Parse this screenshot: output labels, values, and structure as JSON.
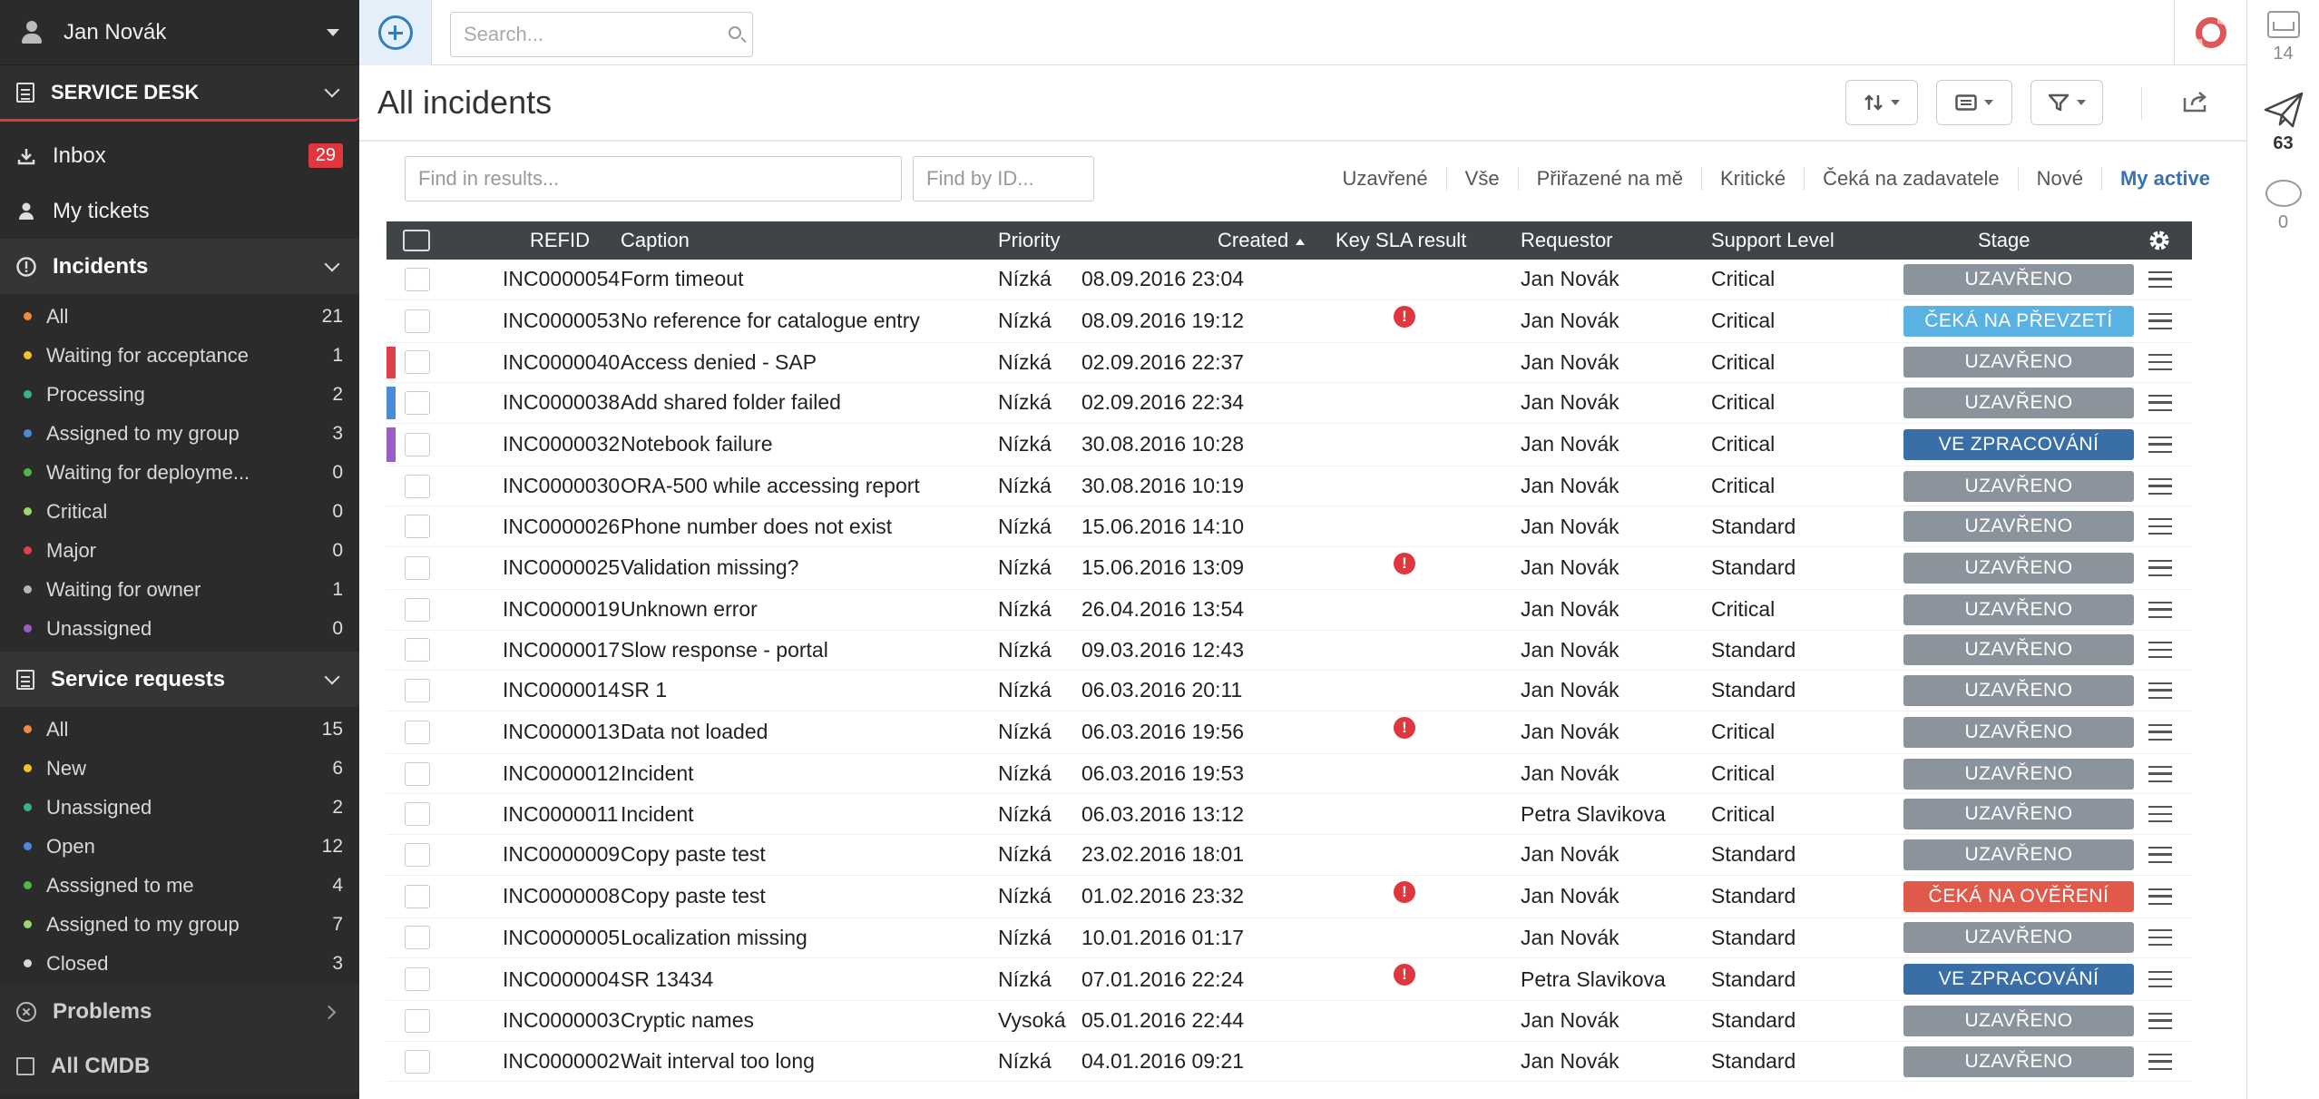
{
  "user": {
    "name": "Jan Novák"
  },
  "sidebar": {
    "service_desk": "SERVICE DESK",
    "inbox": {
      "label": "Inbox",
      "count": "29"
    },
    "my_tickets": "My tickets",
    "incidents": {
      "label": "Incidents",
      "items": [
        {
          "label": "All",
          "count": "21",
          "color": "#f08a3e"
        },
        {
          "label": "Waiting for acceptance",
          "count": "1",
          "color": "#f2c230"
        },
        {
          "label": "Processing",
          "count": "2",
          "color": "#3bb08f"
        },
        {
          "label": "Assigned to my group",
          "count": "3",
          "color": "#4a8ad6"
        },
        {
          "label": "Waiting for deployme...",
          "count": "0",
          "color": "#4cb848"
        },
        {
          "label": "Critical",
          "count": "0",
          "color": "#9bd66b"
        },
        {
          "label": "Major",
          "count": "0",
          "color": "#e0404a"
        },
        {
          "label": "Waiting for owner",
          "count": "1",
          "color": "#b5b5b5"
        },
        {
          "label": "Unassigned",
          "count": "0",
          "color": "#9a5cc6"
        }
      ]
    },
    "service_requests": {
      "label": "Service requests",
      "items": [
        {
          "label": "All",
          "count": "15",
          "color": "#f08a3e"
        },
        {
          "label": "New",
          "count": "6",
          "color": "#f2c230"
        },
        {
          "label": "Unassigned",
          "count": "2",
          "color": "#3bb08f"
        },
        {
          "label": "Open",
          "count": "12",
          "color": "#4a8ad6"
        },
        {
          "label": "Asssigned to me",
          "count": "4",
          "color": "#4cb848"
        },
        {
          "label": "Assigned to my group",
          "count": "7",
          "color": "#9bd66b"
        },
        {
          "label": "Closed",
          "count": "3",
          "color": "#d8d8d8"
        }
      ]
    },
    "problems": "Problems",
    "cmdb": "All CMDB"
  },
  "topbar": {
    "search_placeholder": "Search..."
  },
  "rail": {
    "inbox_count": "14",
    "sent_count": "63",
    "comments_count": "0"
  },
  "main": {
    "title": "All incidents",
    "find_results_placeholder": "Find in results...",
    "find_id_placeholder": "Find by ID...",
    "quick_filters": [
      "Uzavřené",
      "Vše",
      "Přiřazené na mě",
      "Kritické",
      "Čeká na zadavatele",
      "Nové",
      "My active"
    ]
  },
  "table": {
    "headers": {
      "refid": "REFID",
      "caption": "Caption",
      "priority": "Priority",
      "created": "Created",
      "sla": "Key SLA result",
      "requestor": "Requestor",
      "support": "Support Level",
      "stage": "Stage"
    },
    "stage_colors": {
      "UZAVŘENO": "#8b939c",
      "ČEKÁ NA PŘEVZETÍ": "#5ab2e2",
      "VE ZPRACOVÁNÍ": "#3a6ea7",
      "ČEKÁ NA OVĚŘENÍ": "#e0594b"
    },
    "rows": [
      {
        "refid": "INC0000054",
        "caption": "Form timeout",
        "priority": "Nízká",
        "created": "08.09.2016 23:04",
        "sla": false,
        "requestor": "Jan Novák",
        "support": "Critical",
        "stage": "UZAVŘENO",
        "mark": ""
      },
      {
        "refid": "INC0000053",
        "caption": "No reference for catalogue entry",
        "priority": "Nízká",
        "created": "08.09.2016 19:12",
        "sla": true,
        "requestor": "Jan Novák",
        "support": "Critical",
        "stage": "ČEKÁ NA PŘEVZETÍ",
        "mark": ""
      },
      {
        "refid": "INC0000040",
        "caption": "Access denied - SAP",
        "priority": "Nízká",
        "created": "02.09.2016 22:37",
        "sla": false,
        "requestor": "Jan Novák",
        "support": "Critical",
        "stage": "UZAVŘENO",
        "mark": "#e0404a"
      },
      {
        "refid": "INC0000038",
        "caption": "Add shared folder failed",
        "priority": "Nízká",
        "created": "02.09.2016 22:34",
        "sla": false,
        "requestor": "Jan Novák",
        "support": "Critical",
        "stage": "UZAVŘENO",
        "mark": "#4a8ad6"
      },
      {
        "refid": "INC0000032",
        "caption": "Notebook failure",
        "priority": "Nízká",
        "created": "30.08.2016 10:28",
        "sla": false,
        "requestor": "Jan Novák",
        "support": "Critical",
        "stage": "VE ZPRACOVÁNÍ",
        "mark": "#9a5cc6"
      },
      {
        "refid": "INC0000030",
        "caption": "ORA-500 while accessing report",
        "priority": "Nízká",
        "created": "30.08.2016 10:19",
        "sla": false,
        "requestor": "Jan Novák",
        "support": "Critical",
        "stage": "UZAVŘENO",
        "mark": ""
      },
      {
        "refid": "INC0000026",
        "caption": "Phone number does not exist",
        "priority": "Nízká",
        "created": "15.06.2016 14:10",
        "sla": false,
        "requestor": "Jan Novák",
        "support": "Standard",
        "stage": "UZAVŘENO",
        "mark": ""
      },
      {
        "refid": "INC0000025",
        "caption": "Validation missing?",
        "priority": "Nízká",
        "created": "15.06.2016 13:09",
        "sla": true,
        "requestor": "Jan Novák",
        "support": "Standard",
        "stage": "UZAVŘENO",
        "mark": ""
      },
      {
        "refid": "INC0000019",
        "caption": "Unknown error",
        "priority": "Nízká",
        "created": "26.04.2016 13:54",
        "sla": false,
        "requestor": "Jan Novák",
        "support": "Critical",
        "stage": "UZAVŘENO",
        "mark": ""
      },
      {
        "refid": "INC0000017",
        "caption": "Slow response - portal",
        "priority": "Nízká",
        "created": "09.03.2016 12:43",
        "sla": false,
        "requestor": "Jan Novák",
        "support": "Standard",
        "stage": "UZAVŘENO",
        "mark": ""
      },
      {
        "refid": "INC0000014",
        "caption": "SR 1",
        "priority": "Nízká",
        "created": "06.03.2016 20:11",
        "sla": false,
        "requestor": "Jan Novák",
        "support": "Standard",
        "stage": "UZAVŘENO",
        "mark": ""
      },
      {
        "refid": "INC0000013",
        "caption": "Data not loaded",
        "priority": "Nízká",
        "created": "06.03.2016 19:56",
        "sla": true,
        "requestor": "Jan Novák",
        "support": "Critical",
        "stage": "UZAVŘENO",
        "mark": ""
      },
      {
        "refid": "INC0000012",
        "caption": "Incident",
        "priority": "Nízká",
        "created": "06.03.2016 19:53",
        "sla": false,
        "requestor": "Jan Novák",
        "support": "Critical",
        "stage": "UZAVŘENO",
        "mark": ""
      },
      {
        "refid": "INC0000011",
        "caption": "Incident",
        "priority": "Nízká",
        "created": "06.03.2016 13:12",
        "sla": false,
        "requestor": "Petra Slavikova",
        "support": "Critical",
        "stage": "UZAVŘENO",
        "mark": ""
      },
      {
        "refid": "INC0000009",
        "caption": "Copy paste test",
        "priority": "Nízká",
        "created": "23.02.2016 18:01",
        "sla": false,
        "requestor": "Jan Novák",
        "support": "Standard",
        "stage": "UZAVŘENO",
        "mark": ""
      },
      {
        "refid": "INC0000008",
        "caption": "Copy paste test",
        "priority": "Nízká",
        "created": "01.02.2016 23:32",
        "sla": true,
        "requestor": "Jan Novák",
        "support": "Standard",
        "stage": "ČEKÁ NA OVĚŘENÍ",
        "mark": ""
      },
      {
        "refid": "INC0000005",
        "caption": "Localization missing",
        "priority": "Nízká",
        "created": "10.01.2016 01:17",
        "sla": false,
        "requestor": "Jan Novák",
        "support": "Standard",
        "stage": "UZAVŘENO",
        "mark": ""
      },
      {
        "refid": "INC0000004",
        "caption": "SR 13434",
        "priority": "Nízká",
        "created": "07.01.2016 22:24",
        "sla": true,
        "requestor": "Petra Slavikova",
        "support": "Standard",
        "stage": "VE ZPRACOVÁNÍ",
        "mark": ""
      },
      {
        "refid": "INC0000003",
        "caption": "Cryptic names",
        "priority": "Vysoká",
        "created": "05.01.2016 22:44",
        "sla": false,
        "requestor": "Jan Novák",
        "support": "Standard",
        "stage": "UZAVŘENO",
        "mark": ""
      },
      {
        "refid": "INC0000002",
        "caption": "Wait interval too long",
        "priority": "Nízká",
        "created": "04.01.2016 09:21",
        "sla": false,
        "requestor": "Jan Novák",
        "support": "Standard",
        "stage": "UZAVŘENO",
        "mark": ""
      }
    ]
  }
}
